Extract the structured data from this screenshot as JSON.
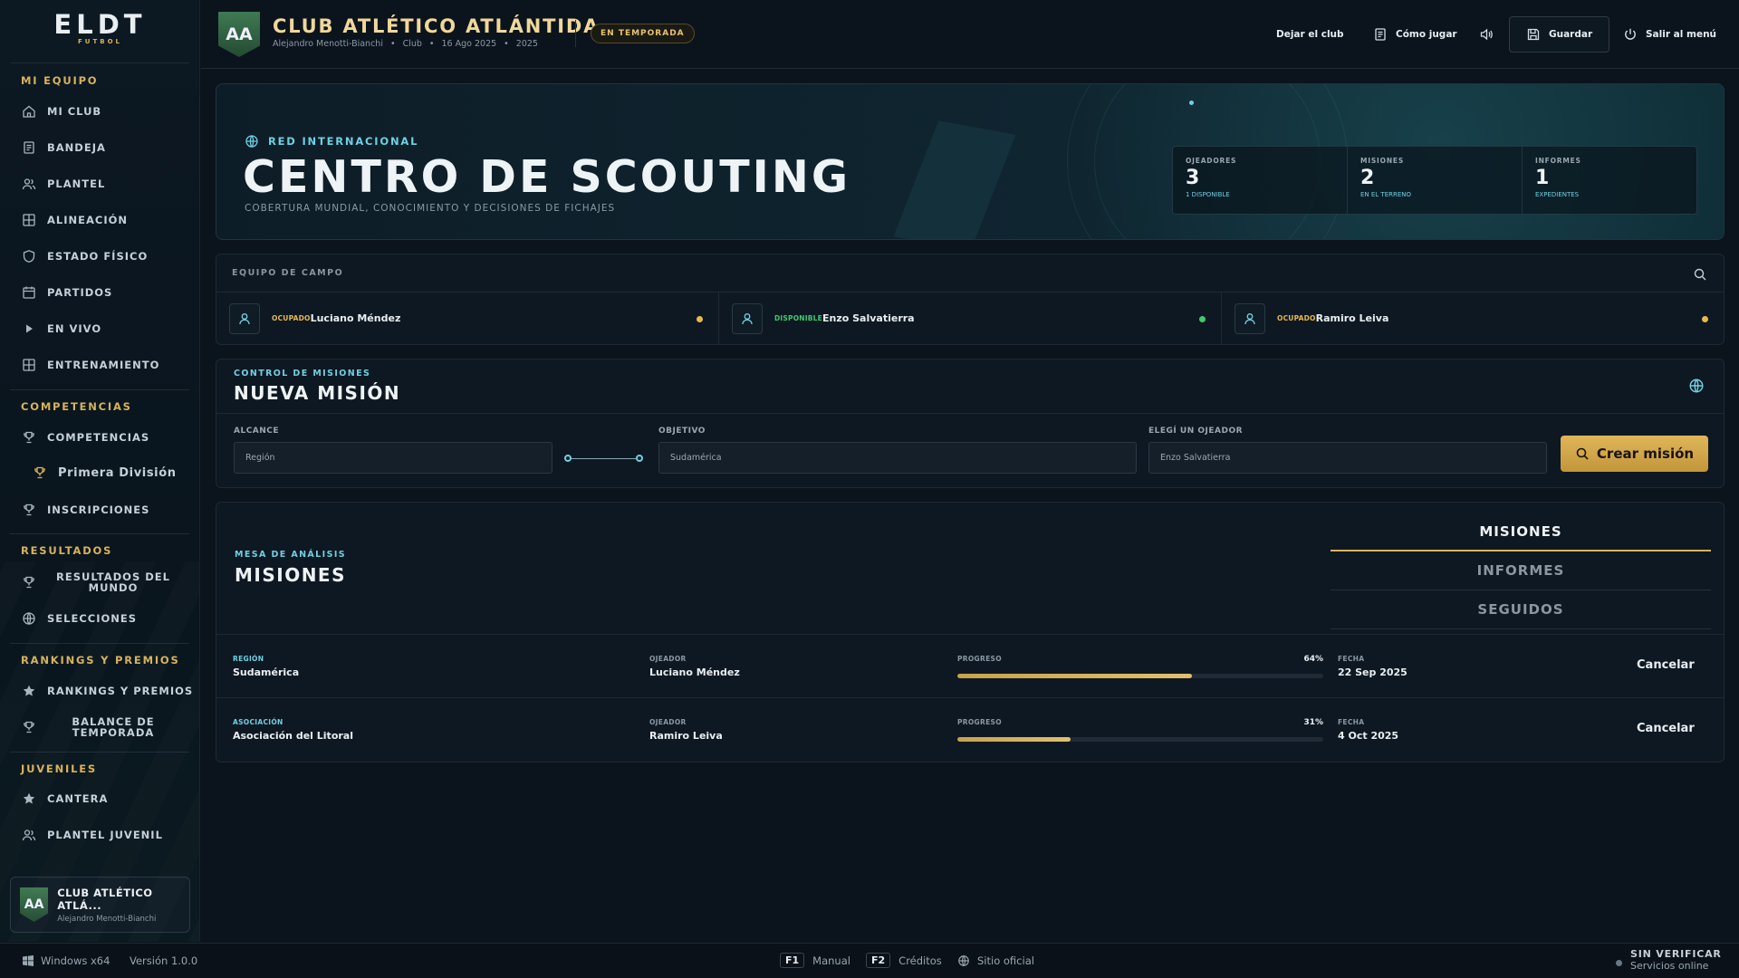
{
  "app": {
    "logo_main": "ELDT",
    "logo_sub": "FUTBOL"
  },
  "sidebar": {
    "sections": [
      {
        "label": "MI EQUIPO"
      },
      {
        "label": "COMPETENCIAS"
      },
      {
        "label": "RESULTADOS"
      },
      {
        "label": "RANKINGS Y PREMIOS"
      },
      {
        "label": "JUVENILES"
      }
    ],
    "items": [
      {
        "label": "MI CLUB",
        "icon": "home-icon"
      },
      {
        "label": "BANDEJA",
        "icon": "inbox-icon"
      },
      {
        "label": "PLANTEL",
        "icon": "users-icon"
      },
      {
        "label": "ALINEACIÓN",
        "icon": "grid-icon"
      },
      {
        "label": "ESTADO FÍSICO",
        "icon": "shield-icon"
      },
      {
        "label": "PARTIDOS",
        "icon": "calendar-icon"
      },
      {
        "label": "EN VIVO",
        "icon": "play-icon"
      },
      {
        "label": "ENTRENAMIENTO",
        "icon": "grid-icon"
      },
      {
        "label": "COMPETENCIAS",
        "icon": "trophy-icon"
      },
      {
        "label": "Primera División",
        "icon": "trophy-icon"
      },
      {
        "label": "INSCRIPCIONES",
        "icon": "trophy-icon"
      },
      {
        "label": "RESULTADOS DEL MUNDO",
        "icon": "trophy-icon"
      },
      {
        "label": "SELECCIONES",
        "icon": "globe-icon"
      },
      {
        "label": "RANKINGS Y PREMIOS",
        "icon": "star-icon"
      },
      {
        "label": "BALANCE DE TEMPORADA",
        "icon": "trophy-icon"
      },
      {
        "label": "CANTERA",
        "icon": "star-icon"
      },
      {
        "label": "PLANTEL JUVENIL",
        "icon": "users-icon"
      }
    ],
    "club_card": {
      "crest": "AA",
      "name": "CLUB ATLÉTICO ATLÁ...",
      "manager": "Alejandro Menotti-Bianchi"
    }
  },
  "header": {
    "crest": "AA",
    "club_name": "CLUB ATLÉTICO ATLÁNTIDA",
    "manager": "Alejandro Menotti-Bianchi",
    "role": "Club",
    "date": "16 Ago 2025",
    "season": "2025",
    "badge": "EN TEMPORADA",
    "actions": {
      "leave": "Dejar el club",
      "how_to": "Cómo jugar",
      "save": "Guardar",
      "exit": "Salir al menú"
    }
  },
  "hero": {
    "eyebrow": "RED INTERNACIONAL",
    "title": "CENTRO DE SCOUTING",
    "subtitle": "COBERTURA MUNDIAL, CONOCIMIENTO Y DECISIONES DE FICHAJES",
    "stats": [
      {
        "label": "OJEADORES",
        "value": "3",
        "sub": "1 DISPONIBLE"
      },
      {
        "label": "MISIONES",
        "value": "2",
        "sub": "EN EL TERRENO"
      },
      {
        "label": "INFORMES",
        "value": "1",
        "sub": "EXPEDIENTES"
      }
    ]
  },
  "field_team": {
    "title": "EQUIPO DE CAMPO",
    "scouts": [
      {
        "status": "OCUPADO",
        "name": "Luciano Méndez",
        "status_color": "#e8b84e"
      },
      {
        "status": "DISPONIBLE",
        "name": "Enzo Salvatierra",
        "status_color": "#3fca6b"
      },
      {
        "status": "OCUPADO",
        "name": "Ramiro Leiva",
        "status_color": "#e8b84e"
      }
    ]
  },
  "mission_control": {
    "eyebrow": "CONTROL DE MISIONES",
    "title": "NUEVA MISIÓN",
    "scope_label": "ALCANCE",
    "scope_value": "Región",
    "target_label": "OBJETIVO",
    "target_value": "Sudamérica",
    "scout_label": "ELEGÍ UN OJEADOR",
    "scout_value": "Enzo Salvatierra",
    "create_button": "Crear misión"
  },
  "analysis": {
    "eyebrow": "MESA DE ANÁLISIS",
    "title": "MISIONES",
    "tabs": [
      "MISIONES",
      "INFORMES",
      "SEGUIDOS"
    ],
    "active_tab": "MISIONES",
    "rows": [
      {
        "type_label": "REGIÓN",
        "type_value": "Sudamérica",
        "scout_label": "OJEADOR",
        "scout": "Luciano Méndez",
        "progress_label": "PROGRESO",
        "progress_pct": 64,
        "progress_text": "64%",
        "date_label": "FECHA",
        "date": "22 Sep 2025",
        "action": "Cancelar"
      },
      {
        "type_label": "ASOCIACIÓN",
        "type_value": "Asociación del Litoral",
        "scout_label": "OJEADOR",
        "scout": "Ramiro Leiva",
        "progress_label": "PROGRESO",
        "progress_pct": 31,
        "progress_text": "31%",
        "date_label": "FECHA",
        "date": "4 Oct 2025",
        "action": "Cancelar"
      }
    ]
  },
  "footer": {
    "os": "Windows x64",
    "version": "Versión 1.0.0",
    "manual_key": "F1",
    "manual": "Manual",
    "credits_key": "F2",
    "credits": "Créditos",
    "site": "Sitio oficial",
    "verify_title": "SIN VERIFICAR",
    "verify_sub": "Servicios online"
  },
  "colors": {
    "gold": "#d8b25a",
    "cyan": "#6fd0e2",
    "busy": "#e8b84e",
    "available": "#3fca6b"
  }
}
